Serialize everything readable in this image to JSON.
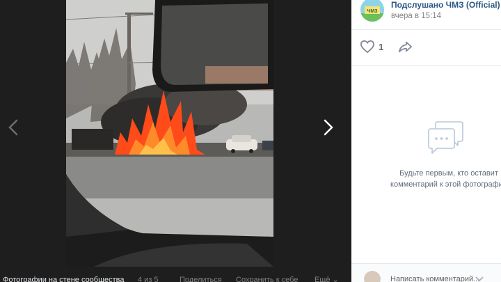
{
  "viewer": {
    "photo_alt_icon": "photo",
    "prev_icon": "chevron-left-icon",
    "next_icon": "chevron-right-icon",
    "bottom_bar": {
      "album_title": "Фотографии на стене сообщества",
      "counter": "4 из 5",
      "share_label": "Поделиться",
      "save_label": "Сохранить к себе",
      "more_label": "Ещё ⌄"
    }
  },
  "side_panel": {
    "author": {
      "name": "Подслушано ЧМЗ (Official)",
      "date": "вчера в 15:14",
      "avatar_text": "ЧМЗ"
    },
    "actions": {
      "like_icon": "heart-icon",
      "like_count": "1",
      "share_icon": "share-arrow-icon"
    },
    "empty_state": {
      "icon": "comments-bubble-icon",
      "line1": "Будьте первым, кто оставит",
      "line2": "комментарий к этой фотографии"
    },
    "composer": {
      "placeholder": "Написать комментарий..."
    }
  },
  "colors": {
    "viewer_bg": "#1e1e1e",
    "link_blue": "#2a5885",
    "muted_text": "#828282",
    "divider": "#e7e8ec",
    "fire": "#ff4a1a"
  }
}
